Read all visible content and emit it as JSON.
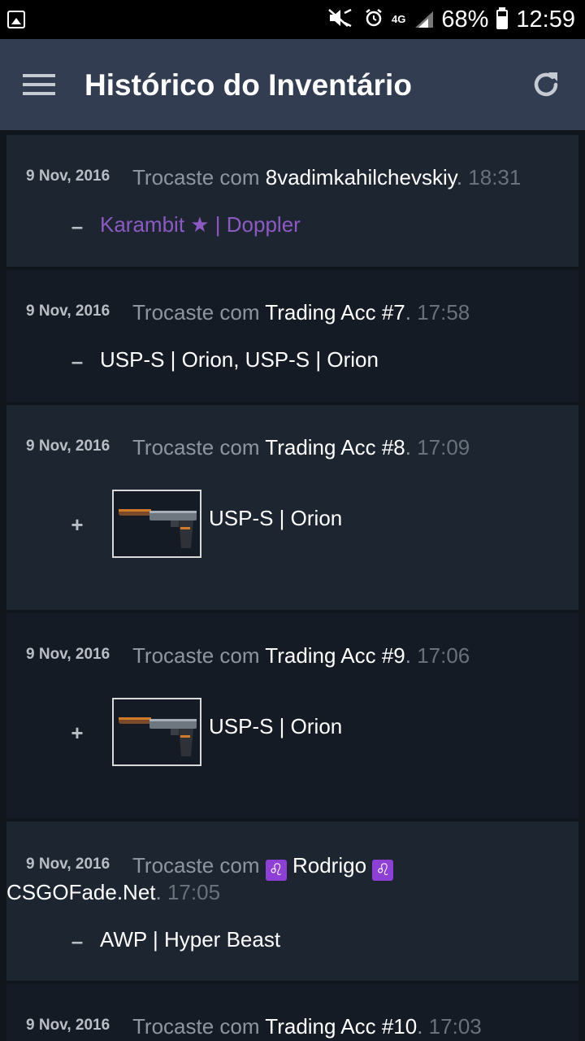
{
  "status_bar": {
    "battery_percent": "68%",
    "time": "12:59",
    "network": "4G"
  },
  "app_bar": {
    "title": "Histórico do Inventário"
  },
  "entries": [
    {
      "date": "9 Nov, 2016",
      "action": "Trocaste com ",
      "partner": "8vadimkahilchevskiy",
      "sep": ".",
      "time": " 18:31",
      "sign": "–",
      "item": "Karambit ★ | Doppler"
    },
    {
      "date": "9 Nov, 2016",
      "action": "Trocaste com ",
      "partner": "Trading Acc #7",
      "sep": ".",
      "time": " 17:58",
      "sign": "–",
      "item": "USP-S | Orion, USP-S | Orion"
    },
    {
      "date": "9 Nov, 2016",
      "action": "Trocaste com ",
      "partner": "Trading Acc #8",
      "sep": ".",
      "time": " 17:09",
      "sign": "+",
      "item": "USP-S | Orion"
    },
    {
      "date": "9 Nov, 2016",
      "action": "Trocaste com ",
      "partner": "Trading Acc #9",
      "sep": ".",
      "time": " 17:06",
      "sign": "+",
      "item": "USP-S | Orion"
    },
    {
      "date": "9 Nov, 2016",
      "action": "Trocaste com ",
      "partner_part1": "Rodrigo",
      "partner_icon": "♌",
      "partner_part2": "CSGOFade.Net",
      "sep": ".",
      "time": " 17:05",
      "sign": "–",
      "item": "AWP | Hyper Beast"
    },
    {
      "date": "9 Nov, 2016",
      "action": "Trocaste com ",
      "partner": "Trading Acc #10",
      "sep": ".",
      "time": " 17:03"
    }
  ],
  "colors": {
    "app_bar": "#323d51",
    "purple_item": "#8d5ac4",
    "entry_bg": "#1c2530"
  }
}
